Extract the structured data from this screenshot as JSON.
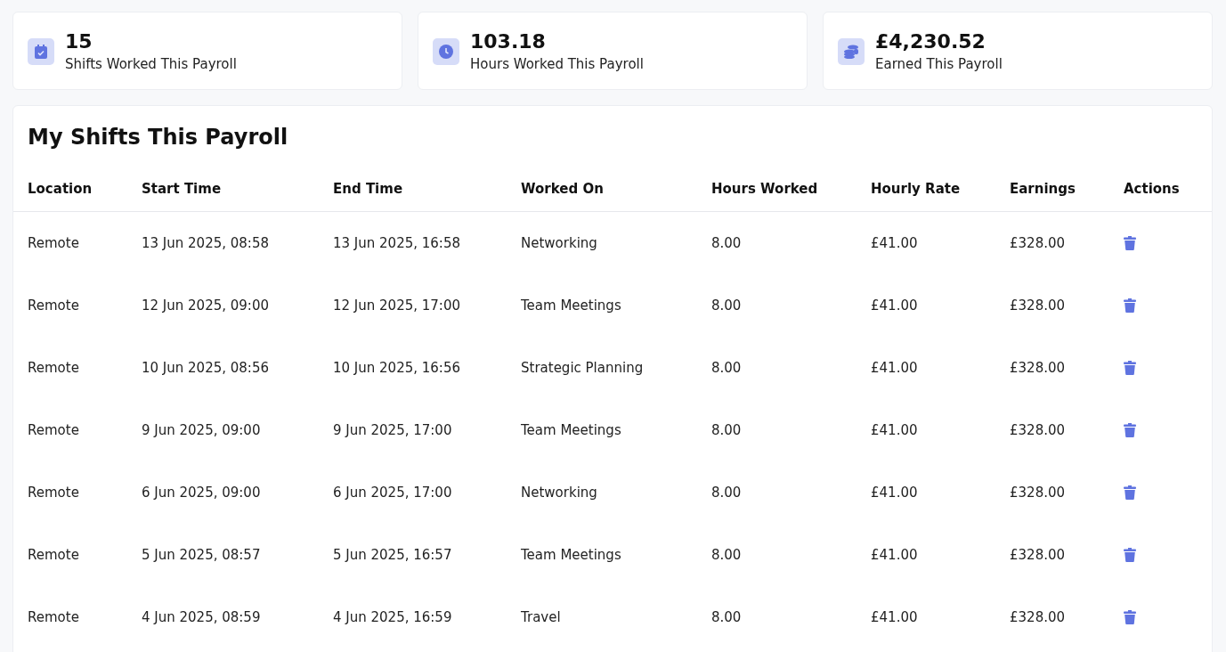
{
  "stats": [
    {
      "kind": "calendar",
      "value": "15",
      "label": "Shifts Worked This Payroll"
    },
    {
      "kind": "clock",
      "value": "103.18",
      "label": "Hours Worked This Payroll"
    },
    {
      "kind": "coins",
      "value": "£4,230.52",
      "label": "Earned This Payroll"
    }
  ],
  "table": {
    "title": "My Shifts This Payroll",
    "columns": [
      "Location",
      "Start Time",
      "End Time",
      "Worked On",
      "Hours Worked",
      "Hourly Rate",
      "Earnings",
      "Actions"
    ],
    "rows": [
      {
        "cells": [
          "Remote",
          "13 Jun 2025, 08:58",
          "13 Jun 2025, 16:58",
          "Networking",
          "8.00",
          "£41.00",
          "£328.00"
        ]
      },
      {
        "cells": [
          "Remote",
          "12 Jun 2025, 09:00",
          "12 Jun 2025, 17:00",
          "Team Meetings",
          "8.00",
          "£41.00",
          "£328.00"
        ]
      },
      {
        "cells": [
          "Remote",
          "10 Jun 2025, 08:56",
          "10 Jun 2025, 16:56",
          "Strategic Planning",
          "8.00",
          "£41.00",
          "£328.00"
        ]
      },
      {
        "cells": [
          "Remote",
          "9 Jun 2025, 09:00",
          "9 Jun 2025, 17:00",
          "Team Meetings",
          "8.00",
          "£41.00",
          "£328.00"
        ]
      },
      {
        "cells": [
          "Remote",
          "6 Jun 2025, 09:00",
          "6 Jun 2025, 17:00",
          "Networking",
          "8.00",
          "£41.00",
          "£328.00"
        ]
      },
      {
        "cells": [
          "Remote",
          "5 Jun 2025, 08:57",
          "5 Jun 2025, 16:57",
          "Team Meetings",
          "8.00",
          "£41.00",
          "£328.00"
        ]
      },
      {
        "cells": [
          "Remote",
          "4 Jun 2025, 08:59",
          "4 Jun 2025, 16:59",
          "Travel",
          "8.00",
          "£41.00",
          "£328.00"
        ]
      }
    ]
  }
}
